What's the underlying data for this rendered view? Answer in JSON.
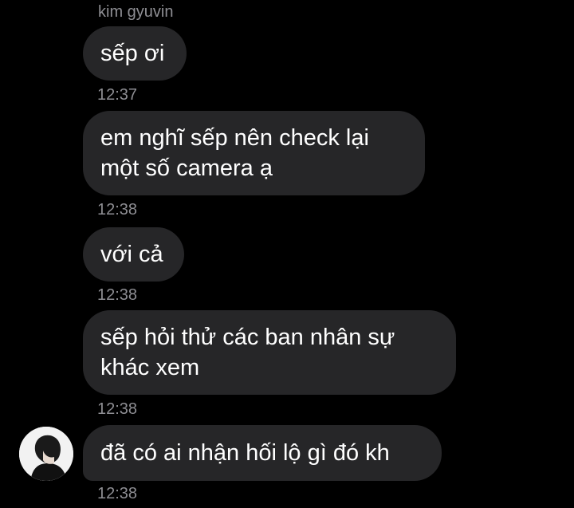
{
  "sender": {
    "name": "kim gyuvin"
  },
  "messages": [
    {
      "text": "sếp ơi",
      "time": "12:37"
    },
    {
      "text": "em nghĩ sếp nên check lại\nmột số camera ạ",
      "time": "12:38"
    },
    {
      "text": "với cả",
      "time": "12:38"
    },
    {
      "text": "sếp hỏi thử các ban nhân sự\nkhác xem",
      "time": "12:38"
    },
    {
      "text": "đã có ai nhận hối lộ gì đó kh",
      "time": "12:38"
    }
  ],
  "colors": {
    "background": "#000000",
    "bubble": "#262628",
    "meta_text": "#8e8e93",
    "message_text": "#ffffff"
  }
}
